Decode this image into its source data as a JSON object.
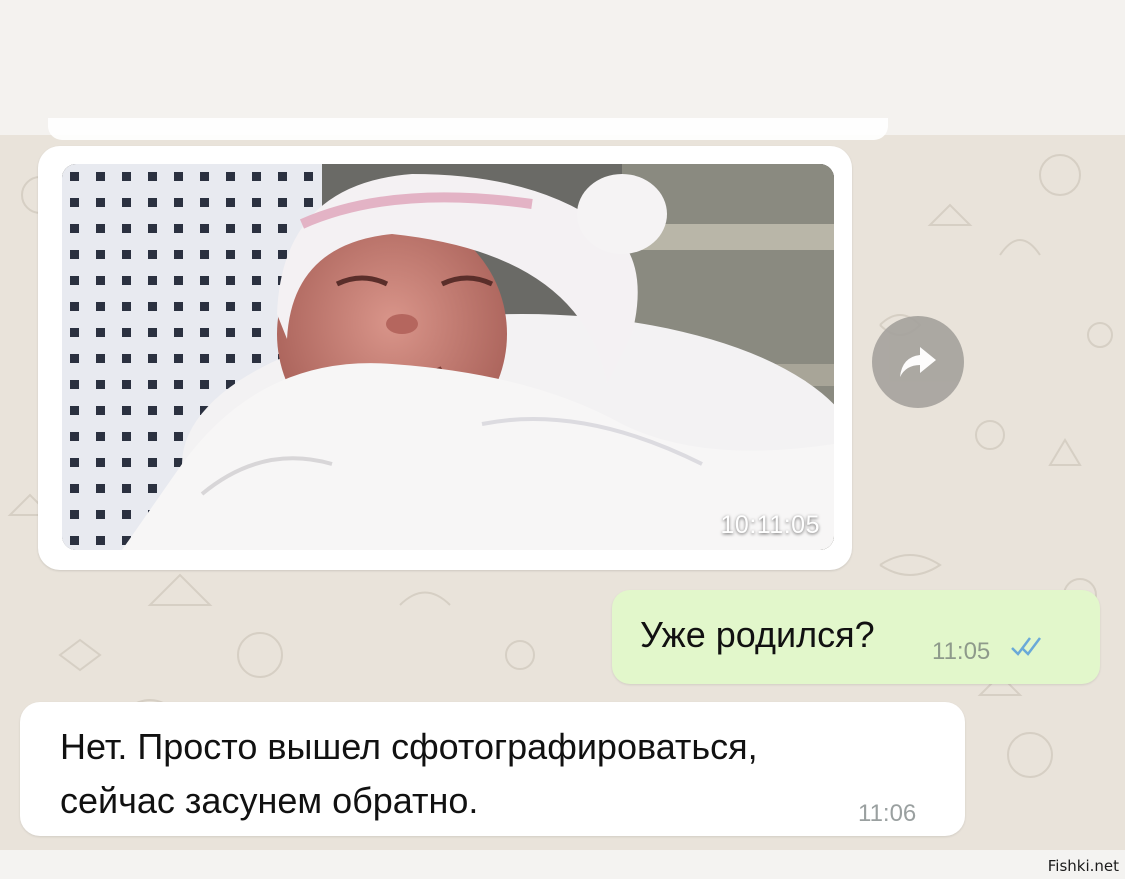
{
  "messages": {
    "image": {
      "time": "10:11:05"
    },
    "outgoing": {
      "text": "Уже родился?",
      "time": "11:05",
      "status": "double-check"
    },
    "incoming": {
      "line1": "Нет. Просто вышел сфотографироваться,",
      "line2": "сейчас засунем обратно.",
      "time": "11:06"
    }
  },
  "watermark": "Fishki.net",
  "icons": {
    "forward": "forward-arrow-icon",
    "ticks": "double-check-icon"
  },
  "colors": {
    "chat_background": "#e9e3da",
    "outgoing_bubble": "#e2f7cb",
    "incoming_bubble": "#ffffff",
    "read_ticks": "#6aa9d8"
  }
}
